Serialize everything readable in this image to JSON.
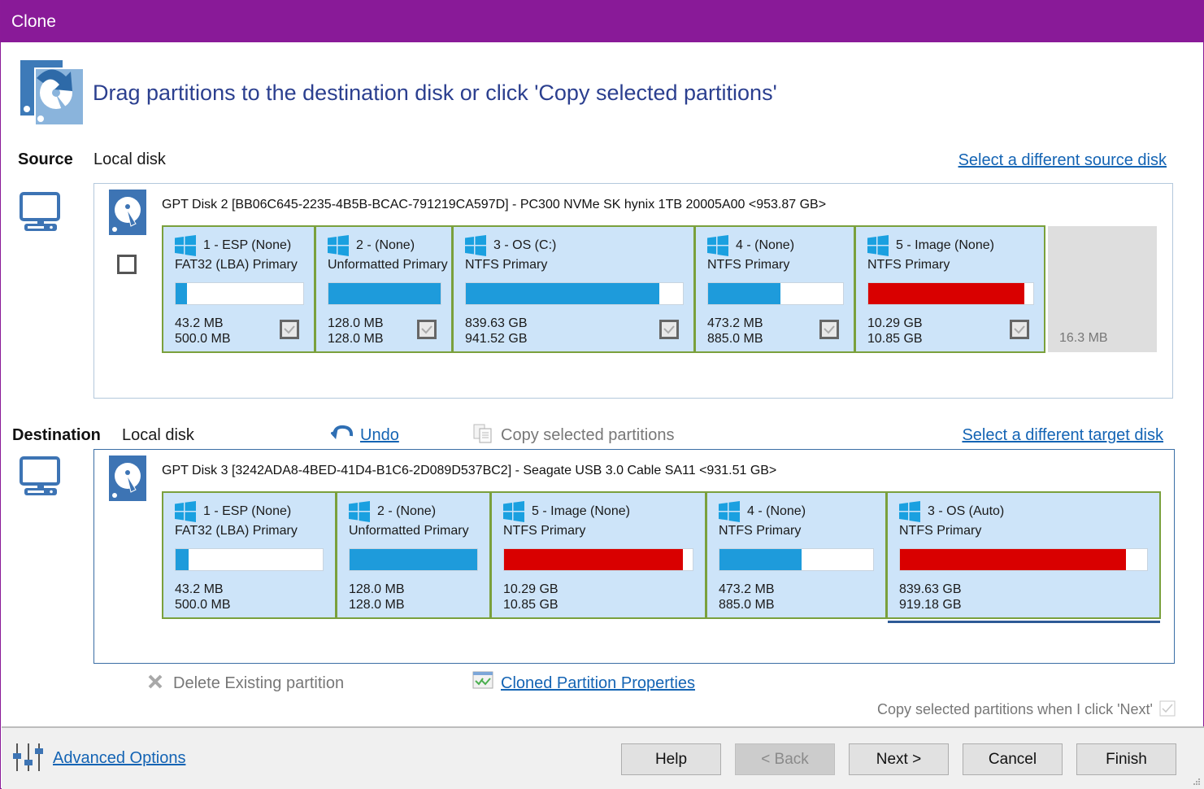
{
  "window": {
    "title": "Clone"
  },
  "header": {
    "instruction": "Drag partitions to the destination disk or click 'Copy selected partitions'"
  },
  "source": {
    "label": "Source",
    "type": "Local disk",
    "select_link": "Select a different source disk",
    "disk_title": "GPT Disk 2 [BB06C645-2235-4B5B-BCAC-791219CA597D] - PC300 NVMe SK hynix 1TB 20005A00  <953.87 GB>",
    "disk_checkbox_checked": false,
    "partitions": [
      {
        "name": "1 - ESP (None)",
        "type": "FAT32 (LBA) Primary",
        "used": "43.2 MB",
        "total": "500.0 MB",
        "usage_pct": 8.6,
        "bar_color": "#1e9bdb",
        "checked": true
      },
      {
        "name": "2 -  (None)",
        "type": "Unformatted Primary",
        "used": "128.0 MB",
        "total": "128.0 MB",
        "usage_pct": 100,
        "bar_color": "#1e9bdb",
        "checked": true
      },
      {
        "name": "3 - OS (C:)",
        "type": "NTFS Primary",
        "used": "839.63 GB",
        "total": "941.52 GB",
        "usage_pct": 89.2,
        "bar_color": "#1e9bdb",
        "checked": true
      },
      {
        "name": "4 -  (None)",
        "type": "NTFS Primary",
        "used": "473.2 MB",
        "total": "885.0 MB",
        "usage_pct": 53.5,
        "bar_color": "#1e9bdb",
        "checked": true
      },
      {
        "name": "5 - Image (None)",
        "type": "NTFS Primary",
        "used": "10.29 GB",
        "total": "10.85 GB",
        "usage_pct": 94.8,
        "bar_color": "#d90000",
        "checked": true
      }
    ],
    "unallocated": "16.3 MB"
  },
  "destination": {
    "label": "Destination",
    "type": "Local disk",
    "undo_label": "Undo",
    "copy_label": "Copy selected partitions",
    "select_link": "Select a different target disk",
    "disk_title": "GPT Disk 3 [3242ADA8-4BED-41D4-B1C6-2D089D537BC2] - Seagate  USB 3.0 Cable    SA11  <931.51 GB>",
    "partitions": [
      {
        "name": "1 - ESP (None)",
        "type": "FAT32 (LBA) Primary",
        "used": "43.2 MB",
        "total": "500.0 MB",
        "usage_pct": 8.6,
        "bar_color": "#1e9bdb"
      },
      {
        "name": "2 -  (None)",
        "type": "Unformatted Primary",
        "used": "128.0 MB",
        "total": "128.0 MB",
        "usage_pct": 100,
        "bar_color": "#1e9bdb"
      },
      {
        "name": "5 - Image (None)",
        "type": "NTFS Primary",
        "used": "10.29 GB",
        "total": "10.85 GB",
        "usage_pct": 94.8,
        "bar_color": "#d90000"
      },
      {
        "name": "4 -  (None)",
        "type": "NTFS Primary",
        "used": "473.2 MB",
        "total": "885.0 MB",
        "usage_pct": 53.5,
        "bar_color": "#1e9bdb"
      },
      {
        "name": "3 - OS (Auto)",
        "type": "NTFS Primary",
        "used": "839.63 GB",
        "total": "919.18 GB",
        "usage_pct": 91.3,
        "bar_color": "#d90000"
      }
    ],
    "selected_partition": "3 - OS (Auto)"
  },
  "actions": {
    "delete_label": "Delete Existing partition",
    "properties_label": "Cloned Partition Properties",
    "copy_on_next_label": "Copy selected partitions when I click 'Next'",
    "copy_on_next_checked": true
  },
  "footer": {
    "advanced_label": "Advanced Options",
    "buttons": {
      "help": "Help",
      "back": "< Back",
      "next": "Next >",
      "cancel": "Cancel",
      "finish": "Finish"
    }
  },
  "colors": {
    "titlebar": "#891a98",
    "partition_bg": "#cde4f9",
    "partition_border": "#7aa03c",
    "used_blue": "#1e9bdb",
    "used_red": "#d90000",
    "link": "#1464b4"
  }
}
